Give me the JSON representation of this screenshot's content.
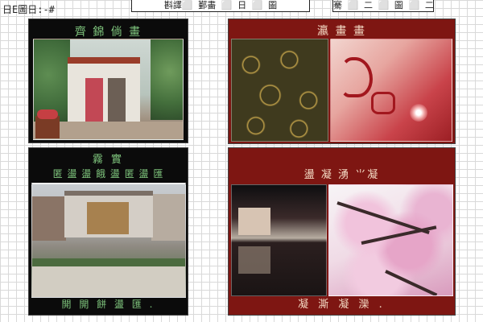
{
  "header": {
    "left_text": "日E圖日:-#",
    "center_label": "斟譯⬜ 鄞畵 ⬜ 日 ⬜ 圖",
    "right_label": "騫 ⬜ 二 ⬜ 圖 ⬜ 二"
  },
  "panels": [
    {
      "id": "storefront",
      "title": "齊 錦 倘 畫",
      "image_icon": "storefront-photo"
    },
    {
      "id": "patterns",
      "title": "瀛 畫 畫",
      "image_icons": [
        "gold-pattern-photo",
        "calligraphy-blossom-photo"
      ]
    },
    {
      "id": "courtyard",
      "title_top": "霧 實",
      "title_sub": "匿 盪 盪 餓 盪 匿 盪 匯",
      "footer": "開 開 餅 盪 匯 .",
      "image_icon": "courtyard-photo"
    },
    {
      "id": "reflection-blossom",
      "title": "盪 凝 湧 ⺌凝",
      "footer": "凝 澌 凝 灤 .",
      "image_icons": [
        "reflection-photo",
        "cherry-blossom-photo"
      ]
    }
  ],
  "colors": {
    "dark_panel": "#0b0b0b",
    "red_panel": "#7e1612",
    "green_text": "#7fc57d",
    "cream_text": "#f3d8c2",
    "grid_line": "#d9d9d9"
  }
}
